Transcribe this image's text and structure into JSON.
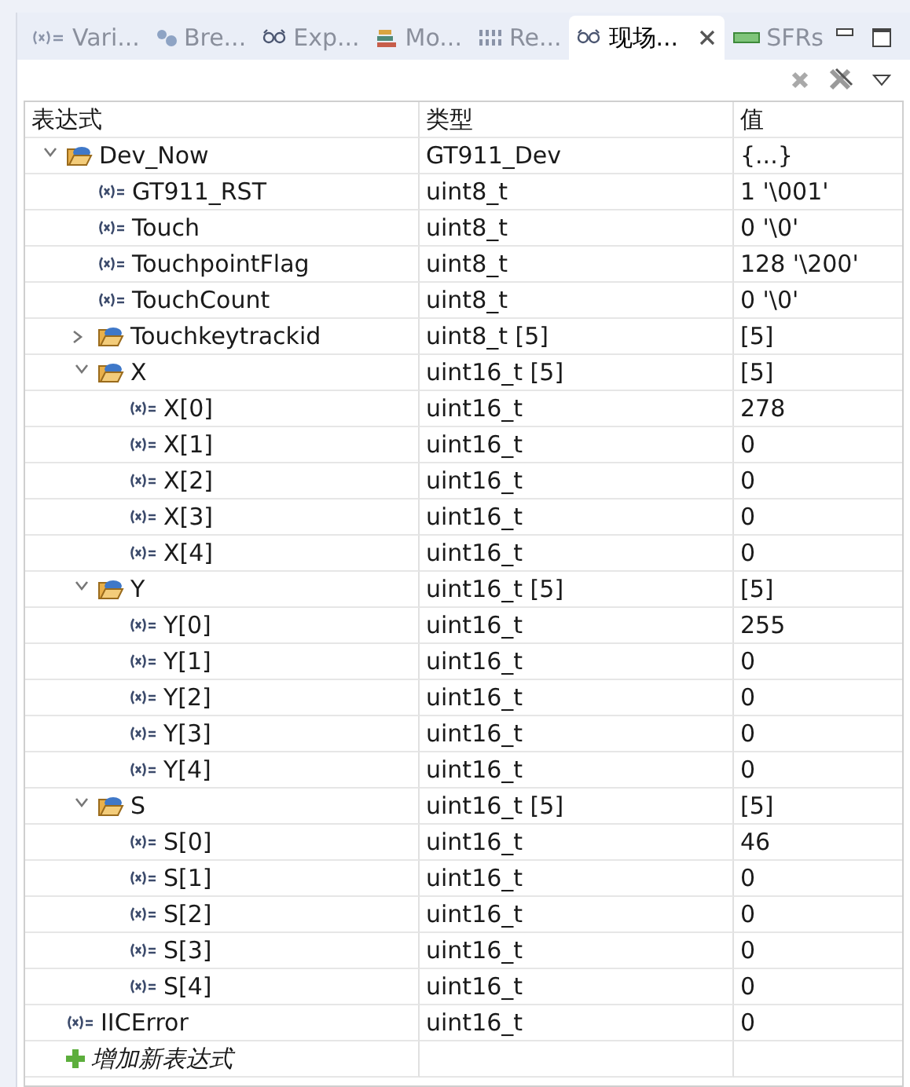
{
  "tabs": [
    {
      "label": "Vari...",
      "kind": "variables",
      "selected": false
    },
    {
      "label": "Bre...",
      "kind": "breakpoints",
      "selected": false
    },
    {
      "label": "Exp...",
      "kind": "expressions",
      "selected": false
    },
    {
      "label": "Mo...",
      "kind": "modules",
      "selected": false
    },
    {
      "label": "Re...",
      "kind": "registers",
      "selected": false
    },
    {
      "label": "现场...",
      "kind": "expressions",
      "selected": true
    },
    {
      "label": "SFRs",
      "kind": "sfrs",
      "selected": false
    }
  ],
  "table": {
    "columns": [
      "表达式",
      "类型",
      "值"
    ],
    "rows": [
      {
        "kind": "struct",
        "name": "Dev_Now",
        "type": "GT911_Dev",
        "value": "{...}",
        "expanded": true,
        "children": [
          {
            "kind": "var",
            "name": "GT911_RST",
            "type": "uint8_t",
            "value": "1 '\\001'"
          },
          {
            "kind": "var",
            "name": "Touch",
            "type": "uint8_t",
            "value": "0 '\\0'"
          },
          {
            "kind": "var",
            "name": "TouchpointFlag",
            "type": "uint8_t",
            "value": "128 '\\200'"
          },
          {
            "kind": "var",
            "name": "TouchCount",
            "type": "uint8_t",
            "value": "0 '\\0'"
          },
          {
            "kind": "struct",
            "name": "Touchkeytrackid",
            "type": "uint8_t [5]",
            "value": "[5]",
            "expanded": false
          },
          {
            "kind": "struct",
            "name": "X",
            "type": "uint16_t [5]",
            "value": "[5]",
            "expanded": true,
            "children": [
              {
                "kind": "var",
                "name": "X[0]",
                "type": "uint16_t",
                "value": "278"
              },
              {
                "kind": "var",
                "name": "X[1]",
                "type": "uint16_t",
                "value": "0"
              },
              {
                "kind": "var",
                "name": "X[2]",
                "type": "uint16_t",
                "value": "0"
              },
              {
                "kind": "var",
                "name": "X[3]",
                "type": "uint16_t",
                "value": "0"
              },
              {
                "kind": "var",
                "name": "X[4]",
                "type": "uint16_t",
                "value": "0"
              }
            ]
          },
          {
            "kind": "struct",
            "name": "Y",
            "type": "uint16_t [5]",
            "value": "[5]",
            "expanded": true,
            "children": [
              {
                "kind": "var",
                "name": "Y[0]",
                "type": "uint16_t",
                "value": "255"
              },
              {
                "kind": "var",
                "name": "Y[1]",
                "type": "uint16_t",
                "value": "0"
              },
              {
                "kind": "var",
                "name": "Y[2]",
                "type": "uint16_t",
                "value": "0"
              },
              {
                "kind": "var",
                "name": "Y[3]",
                "type": "uint16_t",
                "value": "0"
              },
              {
                "kind": "var",
                "name": "Y[4]",
                "type": "uint16_t",
                "value": "0"
              }
            ]
          },
          {
            "kind": "struct",
            "name": "S",
            "type": "uint16_t [5]",
            "value": "[5]",
            "expanded": true,
            "children": [
              {
                "kind": "var",
                "name": "S[0]",
                "type": "uint16_t",
                "value": "46"
              },
              {
                "kind": "var",
                "name": "S[1]",
                "type": "uint16_t",
                "value": "0"
              },
              {
                "kind": "var",
                "name": "S[2]",
                "type": "uint16_t",
                "value": "0"
              },
              {
                "kind": "var",
                "name": "S[3]",
                "type": "uint16_t",
                "value": "0"
              },
              {
                "kind": "var",
                "name": "S[4]",
                "type": "uint16_t",
                "value": "0"
              }
            ]
          }
        ]
      },
      {
        "kind": "var",
        "name": "IICError",
        "type": "uint16_t",
        "value": "0"
      },
      {
        "kind": "add",
        "name": "增加新表达式"
      }
    ]
  }
}
